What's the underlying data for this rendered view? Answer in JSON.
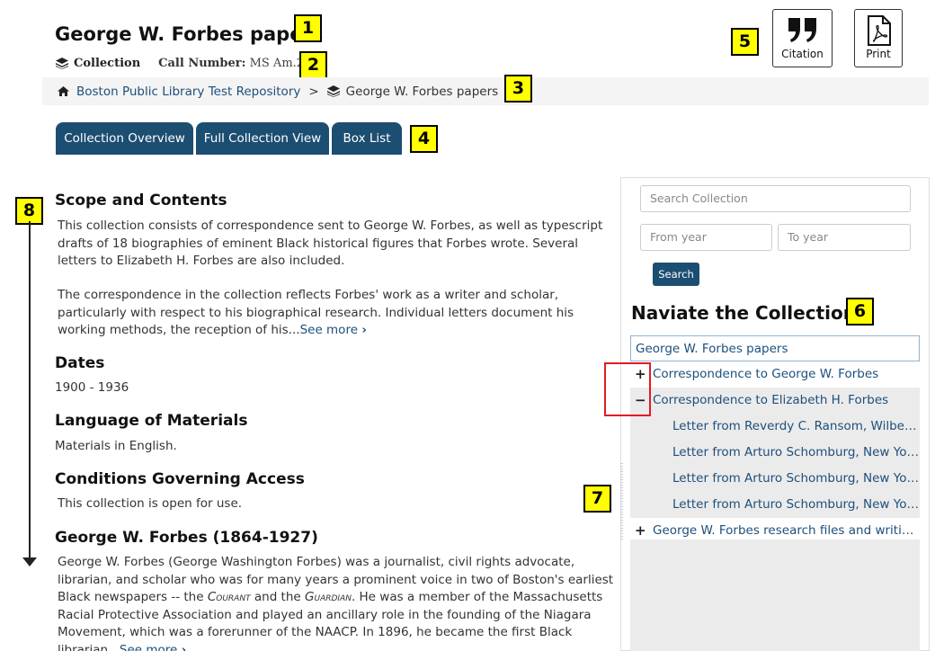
{
  "header": {
    "title": "George W. Forbes papers",
    "type_label": "Collection",
    "call_number_label": "Call Number:",
    "call_number": "MS Am.282"
  },
  "breadcrumb": {
    "repository": "Boston Public Library Test Repository",
    "separator": ">",
    "current": "George W. Forbes papers"
  },
  "tabs": [
    {
      "label": "Collection Overview"
    },
    {
      "label": "Full Collection View"
    },
    {
      "label": "Box List"
    }
  ],
  "tools": {
    "citation_label": "Citation",
    "print_label": "Print"
  },
  "badges": [
    "1",
    "2",
    "3",
    "4",
    "5",
    "6",
    "7",
    "8"
  ],
  "main": {
    "scope_heading": "Scope and Contents",
    "scope_p1": "This collection consists of correspondence sent to George W. Forbes, as well as typescript drafts of 18 biographies of eminent Black historical figures that Forbes wrote. Several letters to Elizabeth H. Forbes are also included.",
    "scope_p2": "The correspondence in the collection reflects Forbes' work as a writer and scholar, particularly with respect to his biographical research. Individual letters document his working methods, the reception of his...",
    "see_more": "See more",
    "dates_heading": "Dates",
    "dates_value": "1900 - 1936",
    "language_heading": "Language of Materials",
    "language_value": "Materials in English.",
    "access_heading": "Conditions Governing Access",
    "access_value": "This collection is open for use.",
    "bio_heading": "George W. Forbes (1864-1927)",
    "bio_p_a": "George W. Forbes (George Washington Forbes) was a journalist, civil rights advocate, librarian, and scholar who was for many years a prominent voice in two of Boston's earliest Black newspapers -- the ",
    "bio_courant": "Courant",
    "bio_and": " and the ",
    "bio_guardian": "Guardian",
    "bio_p_b": ". He was a member of the Massachusetts Racial Protective Association and played an ancillary role in the founding of the Niagara Movement, which was a forerunner of the NAACP. In 1896, he became the first Black librarian...",
    "bio_see_more": "See more"
  },
  "sidebar": {
    "search_placeholder": "Search Collection",
    "from_placeholder": "From year",
    "to_placeholder": "To year",
    "search_button": "Search",
    "nav_title": "Naviate the Collection",
    "tree": [
      {
        "label": "George W. Forbes papers"
      },
      {
        "label": "Correspondence to George W. Forbes",
        "toggle": "+"
      },
      {
        "label": "Correspondence to Elizabeth H. Forbes",
        "toggle": "−"
      },
      {
        "label": "Letter from Reverdy C. Ransom, Wilberforce, Ohio"
      },
      {
        "label": "Letter from Arturo Schomburg, New York, N.Y."
      },
      {
        "label": "Letter from Arturo Schomburg, New York, N.Y."
      },
      {
        "label": "Letter from Arturo Schomburg, New York, N.Y."
      },
      {
        "label": "George W. Forbes research files and writings",
        "toggle": "+"
      }
    ]
  },
  "colors": {
    "tab_bg": "#1c4e72",
    "link": "#1d4f7c",
    "badge_bg": "#ffff00",
    "highlight_border": "#e21b23"
  }
}
